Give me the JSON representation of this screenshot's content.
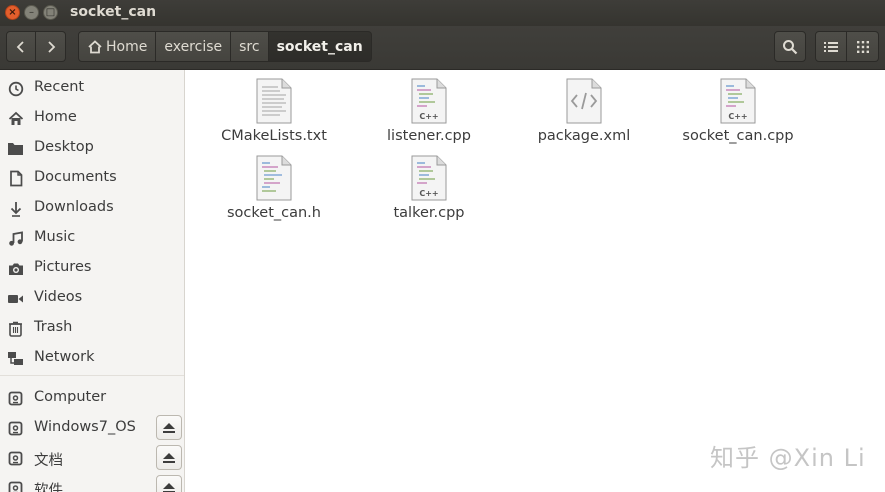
{
  "window": {
    "title": "socket_can",
    "controls": {
      "close_glyph": "×",
      "minimize_glyph": "–",
      "maximize_glyph": "□"
    }
  },
  "toolbar": {
    "back_icon": "chevron-left-icon",
    "forward_icon": "chevron-right-icon",
    "breadcrumbs": [
      {
        "label": "Home",
        "icon": "home-icon"
      },
      {
        "label": "exercise"
      },
      {
        "label": "src"
      },
      {
        "label": "socket_can"
      }
    ],
    "search_icon": "search-icon",
    "list_view_icon": "list-view-icon",
    "grid_view_icon": "grid-view-icon"
  },
  "sidebar": {
    "places": [
      {
        "label": "Recent",
        "icon": "clock-icon"
      },
      {
        "label": "Home",
        "icon": "home-icon"
      },
      {
        "label": "Desktop",
        "icon": "folder-icon"
      },
      {
        "label": "Documents",
        "icon": "document-icon"
      },
      {
        "label": "Downloads",
        "icon": "download-icon"
      },
      {
        "label": "Music",
        "icon": "music-icon"
      },
      {
        "label": "Pictures",
        "icon": "camera-icon"
      },
      {
        "label": "Videos",
        "icon": "video-icon"
      },
      {
        "label": "Trash",
        "icon": "trash-icon"
      },
      {
        "label": "Network",
        "icon": "network-icon"
      }
    ],
    "devices": [
      {
        "label": "Computer",
        "icon": "drive-icon",
        "eject": false
      },
      {
        "label": "Windows7_OS",
        "icon": "drive-icon",
        "eject": true
      },
      {
        "label": "文档",
        "icon": "drive-icon",
        "eject": true
      },
      {
        "label": "软件",
        "icon": "drive-icon",
        "eject": true
      }
    ]
  },
  "files": [
    {
      "name": "CMakeLists.txt",
      "type": "text"
    },
    {
      "name": "listener.cpp",
      "type": "cpp"
    },
    {
      "name": "package.xml",
      "type": "xml"
    },
    {
      "name": "socket_can.cpp",
      "type": "cpp"
    },
    {
      "name": "socket_can.h",
      "type": "header"
    },
    {
      "name": "talker.cpp",
      "type": "cpp"
    }
  ],
  "watermark": "知乎 @Xin Li",
  "colors": {
    "titlebar": "#3c3b37",
    "toolbar": "#3e3d39",
    "sidebar": "#f5f4f2",
    "close_button": "#e35e2c"
  }
}
